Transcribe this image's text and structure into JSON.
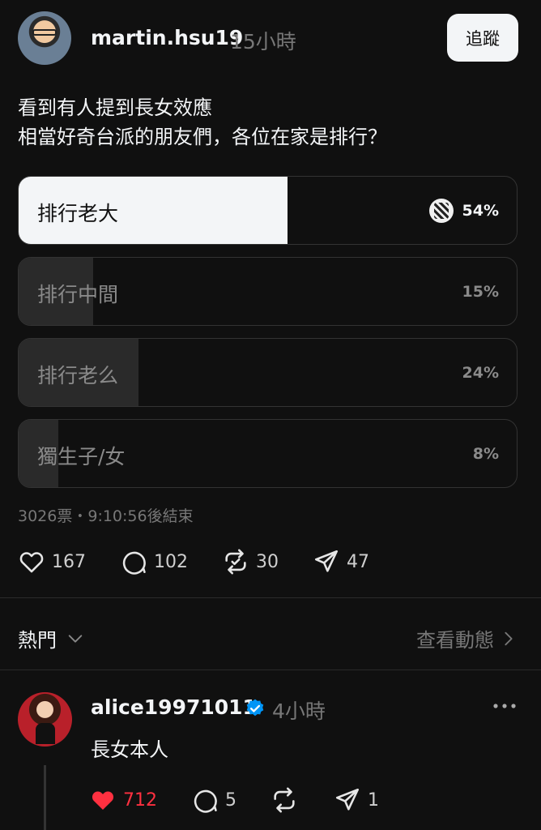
{
  "post": {
    "username": "martin.hsu19",
    "time": "15小時",
    "follow_label": "追蹤",
    "text_line1": "看到有人提到長女效應",
    "text_line2": "相當好奇台派的朋友們，各位在家是排行？",
    "poll": {
      "options": [
        {
          "label": "排行老大",
          "percent": "54%",
          "fraction": 0.54,
          "selected": true
        },
        {
          "label": "排行中間",
          "percent": "15%",
          "fraction": 0.15,
          "selected": false
        },
        {
          "label": "排行老么",
          "percent": "24%",
          "fraction": 0.24,
          "selected": false
        },
        {
          "label": "獨生子/女",
          "percent": "8%",
          "fraction": 0.08,
          "selected": false
        }
      ],
      "meta": "3026票・9:10:56後結束"
    },
    "actions": {
      "likes": "167",
      "comments": "102",
      "reposts": "30",
      "shares": "47"
    }
  },
  "sort": {
    "label": "熱門",
    "view_activity": "查看動態"
  },
  "reply": {
    "username": "alice19971011",
    "time": "4小時",
    "text": "長女本人",
    "actions": {
      "likes": "712",
      "comments": "5",
      "shares": "1"
    }
  },
  "colors": {
    "like_active": "#ff3040",
    "verified": "#0095f6",
    "background": "#101010"
  }
}
